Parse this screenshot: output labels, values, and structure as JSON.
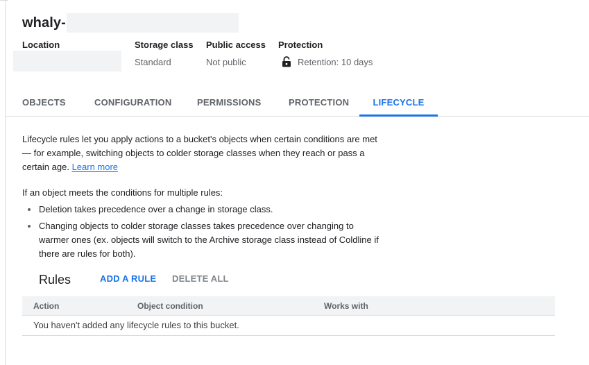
{
  "header": {
    "bucket_name_prefix": "whaly-"
  },
  "meta": {
    "location": {
      "label": "Location"
    },
    "storage_class": {
      "label": "Storage class",
      "value": "Standard"
    },
    "public_access": {
      "label": "Public access",
      "value": "Not public"
    },
    "protection": {
      "label": "Protection",
      "value": "Retention: 10 days",
      "icon": "unlock-icon"
    }
  },
  "tabs": [
    {
      "label": "OBJECTS"
    },
    {
      "label": "CONFIGURATION"
    },
    {
      "label": "PERMISSIONS"
    },
    {
      "label": "PROTECTION"
    },
    {
      "label": "LIFECYCLE",
      "selected": true
    }
  ],
  "lifecycle": {
    "intro": "Lifecycle rules let you apply actions to a bucket's objects when certain conditions are met — for example, switching objects to colder storage classes when they reach or pass a certain age.",
    "learn_more": "Learn more",
    "conditions_intro": "If an object meets the conditions for multiple rules:",
    "bullets": [
      "Deletion takes precedence over a change in storage class.",
      "Changing objects to colder storage classes takes precedence over changing to warmer ones (ex. objects will switch to the Archive storage class instead of Coldline if there are rules for both)."
    ]
  },
  "rules": {
    "title": "Rules",
    "add_label": "ADD A RULE",
    "delete_all_label": "DELETE ALL",
    "columns": [
      "Action",
      "Object condition",
      "Works with"
    ],
    "empty_message": "You haven't added any lifecycle rules to this bucket."
  },
  "colors": {
    "accent": "#1a73e8",
    "muted_text": "#5f6368",
    "header_bg": "#f1f3f4"
  }
}
